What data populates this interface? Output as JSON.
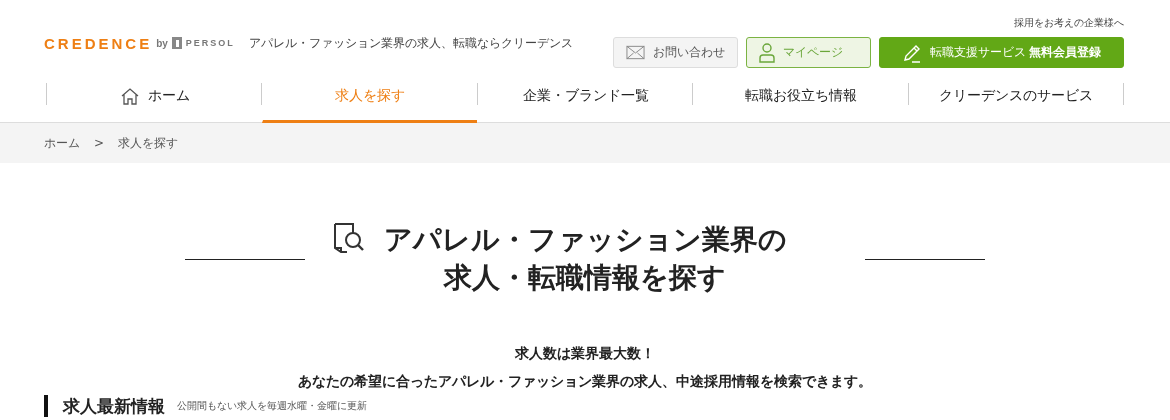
{
  "header": {
    "logo": {
      "brand": "CREDENCE",
      "by": "by",
      "parent": "PERSOL"
    },
    "tagline": "アパレル・ファッション業界の求人、転職ならクリーデンス",
    "corporate_link": "採用をお考えの企業様へ",
    "buttons": [
      {
        "kind": "contact",
        "label": "お問い合わせ"
      },
      {
        "kind": "mypage",
        "label": "マイページ"
      },
      {
        "kind": "register",
        "label": "転職支援サービス **無料会員登録**"
      }
    ]
  },
  "nav": [
    {
      "kind": "home",
      "label": "ホーム",
      "selected": false
    },
    {
      "kind": "link",
      "label": "求人を探す",
      "selected": true
    },
    {
      "kind": "link",
      "label": "企業・ブランド一覧",
      "selected": false
    },
    {
      "kind": "link",
      "label": "転職お役立ち情報",
      "selected": false
    },
    {
      "kind": "link",
      "label": "クリーデンスのサービス",
      "selected": false
    }
  ],
  "breadcrumb": [
    {
      "label": "ホーム"
    },
    {
      "label": "求人を探す"
    }
  ],
  "breadcrumb_separator": ">",
  "title_lines": [
    "アパレル・ファッション業界の",
    "求人・転職情報を探す"
  ],
  "lead_lines": [
    "求人数は業界最大数！",
    "あなたの希望に合ったアパレル・ファッション業界の求人、中途採用情報を検索できます。"
  ],
  "section": {
    "heading": "求人最新情報",
    "note": "公開間もない求人を毎週水曜・金曜に更新"
  }
}
